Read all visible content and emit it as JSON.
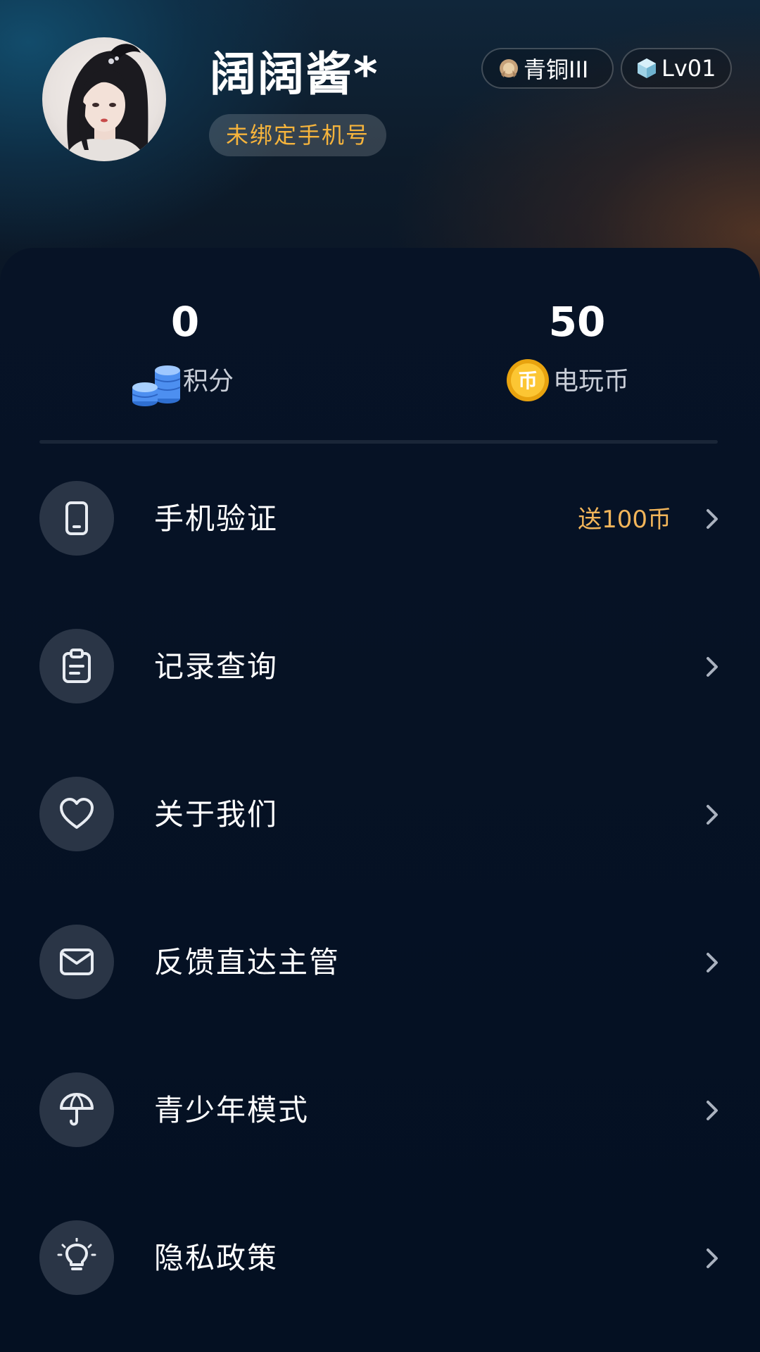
{
  "profile": {
    "username": "阔阔酱*",
    "phone_status": "未绑定手机号",
    "rank_badge": "青铜III",
    "level_badge": "Lv01"
  },
  "stats": {
    "points_value": "0",
    "points_label": "积分",
    "coins_value": "50",
    "coins_label": "电玩币",
    "coin_glyph": "币"
  },
  "menu": {
    "items": [
      {
        "label": "手机验证",
        "extra": "送100币",
        "icon": "phone-icon"
      },
      {
        "label": "记录查询",
        "extra": "",
        "icon": "clipboard-icon"
      },
      {
        "label": "关于我们",
        "extra": "",
        "icon": "heart-icon"
      },
      {
        "label": "反馈直达主管",
        "extra": "",
        "icon": "mail-icon"
      },
      {
        "label": "青少年模式",
        "extra": "",
        "icon": "umbrella-icon"
      },
      {
        "label": "隐私政策",
        "extra": "",
        "icon": "lightbulb-icon"
      }
    ]
  },
  "colors": {
    "accent_gold": "#f6b43c",
    "reward_text": "#f2b55a",
    "background": "#041024",
    "icon_circle": "#2a3546"
  }
}
